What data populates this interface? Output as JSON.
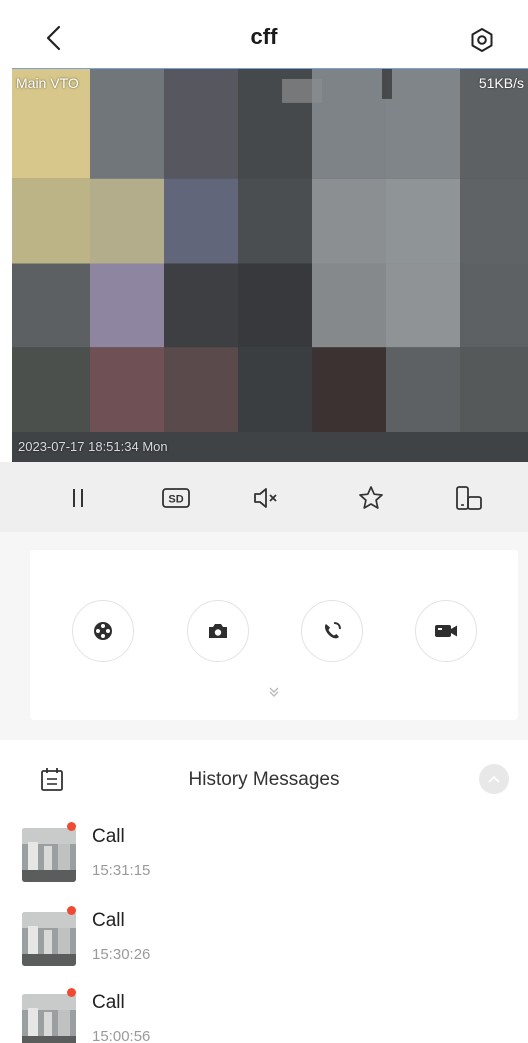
{
  "header": {
    "title": "cff",
    "back_icon": "chevron-left-icon",
    "settings_icon": "settings-gear-icon"
  },
  "video": {
    "channel_name": "Main VTO",
    "bitrate": "51KB/s",
    "timestamp": "2023-07-17 18:51:34 Mon"
  },
  "controls": [
    {
      "name": "pause",
      "icon": "pause-icon"
    },
    {
      "name": "stream-quality",
      "icon": "sd-quality-icon",
      "label": "SD"
    },
    {
      "name": "mute",
      "icon": "speaker-muted-icon"
    },
    {
      "name": "favorite",
      "icon": "star-icon"
    },
    {
      "name": "fullscreen",
      "icon": "rotate-landscape-icon"
    }
  ],
  "actions": [
    {
      "name": "ptz",
      "icon": "joystick-icon"
    },
    {
      "name": "snapshot",
      "icon": "camera-icon"
    },
    {
      "name": "call",
      "icon": "phone-call-icon"
    },
    {
      "name": "record",
      "icon": "video-record-icon"
    }
  ],
  "history": {
    "title": "History Messages",
    "items": [
      {
        "type": "Call",
        "time": "15:31:15",
        "unread": true
      },
      {
        "type": "Call",
        "time": "15:30:26",
        "unread": true
      },
      {
        "type": "Call",
        "time": "15:00:56",
        "unread": true
      }
    ]
  },
  "colors": {
    "unread_dot": "#f04a33",
    "control_bar_bg": "#efefef",
    "panel_bg": "#f6f6f6"
  }
}
